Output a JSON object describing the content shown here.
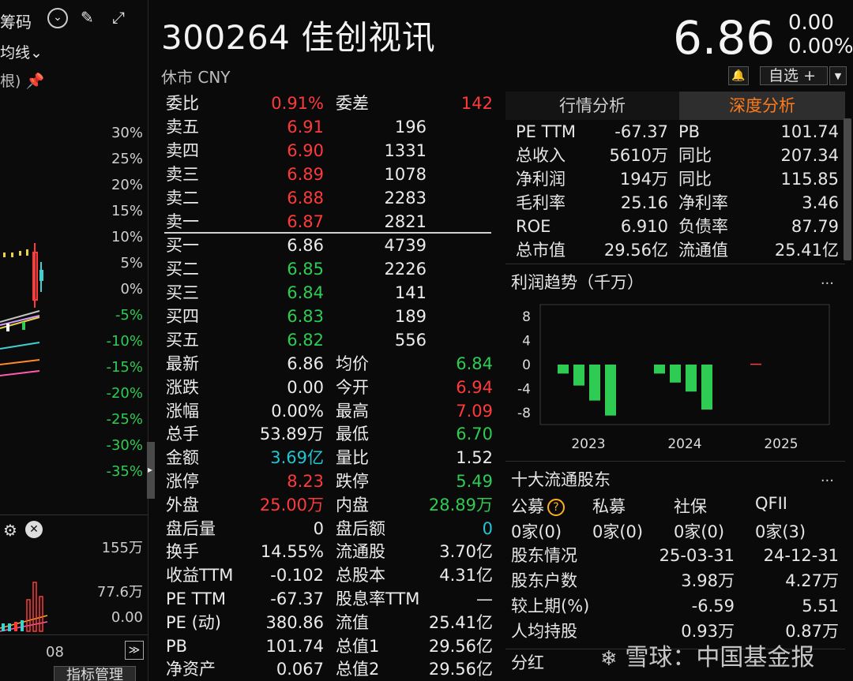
{
  "left_panel": {
    "top_label": "筹码",
    "ma_label": "均线",
    "ma_chevron": "⌄",
    "bracket_label": "根)",
    "y_axis": [
      "30%",
      "25%",
      "20%",
      "15%",
      "10%",
      "5%",
      "0%",
      "-5%",
      "-10%",
      "-15%",
      "-20%",
      "-25%",
      "-30%",
      "-35%"
    ],
    "y_axis_colors": [
      "#d0d0d0",
      "#d0d0d0",
      "#d0d0d0",
      "#d0d0d0",
      "#d0d0d0",
      "#d0d0d0",
      "#d0d0d0",
      "#2ecc52",
      "#2ecc52",
      "#2ecc52",
      "#2ecc52",
      "#2ecc52",
      "#2ecc52",
      "#2ecc52"
    ],
    "vol_axis": [
      "155万",
      "77.6万",
      "0.00"
    ],
    "date_label": "08",
    "indicator_btn": "指标管理",
    "expand_arrow": "▸",
    "nav_right": "≫"
  },
  "header": {
    "code": "300264",
    "name": "佳创视讯",
    "market": "休市 CNY",
    "price": "6.86",
    "change": "0.00",
    "change_pct": "0.00%",
    "watch_label": "自选",
    "watch_plus": "+",
    "drop_arrow": "▼",
    "bell_glyph": "🔔"
  },
  "quote": {
    "top": {
      "l1": "委比",
      "v1": "0.91%",
      "l2": "委差",
      "v2": "142"
    },
    "asks": [
      {
        "label": "卖五",
        "price": "6.91",
        "vol": "196"
      },
      {
        "label": "卖四",
        "price": "6.90",
        "vol": "1331"
      },
      {
        "label": "卖三",
        "price": "6.89",
        "vol": "1078"
      },
      {
        "label": "卖二",
        "price": "6.88",
        "vol": "2283"
      },
      {
        "label": "卖一",
        "price": "6.87",
        "vol": "2821"
      }
    ],
    "bids": [
      {
        "label": "买一",
        "price": "6.86",
        "vol": "4739"
      },
      {
        "label": "买二",
        "price": "6.85",
        "vol": "2226"
      },
      {
        "label": "买三",
        "price": "6.84",
        "vol": "141"
      },
      {
        "label": "买四",
        "price": "6.83",
        "vol": "189"
      },
      {
        "label": "买五",
        "price": "6.82",
        "vol": "556"
      }
    ],
    "stats": [
      {
        "l1": "最新",
        "v1": "6.86",
        "c1": "white",
        "l2": "均价",
        "v2": "6.84",
        "c2": "green"
      },
      {
        "l1": "涨跌",
        "v1": "0.00",
        "c1": "white",
        "l2": "今开",
        "v2": "6.94",
        "c2": "red"
      },
      {
        "l1": "涨幅",
        "v1": "0.00%",
        "c1": "white",
        "l2": "最高",
        "v2": "7.09",
        "c2": "red"
      },
      {
        "l1": "总手",
        "v1": "53.89万",
        "c1": "white",
        "l2": "最低",
        "v2": "6.70",
        "c2": "green"
      },
      {
        "l1": "金额",
        "v1": "3.69亿",
        "c1": "cyan",
        "l2": "量比",
        "v2": "1.52",
        "c2": "white"
      },
      {
        "l1": "涨停",
        "v1": "8.23",
        "c1": "red",
        "l2": "跌停",
        "v2": "5.49",
        "c2": "green"
      },
      {
        "l1": "外盘",
        "v1": "25.00万",
        "c1": "red",
        "l2": "内盘",
        "v2": "28.89万",
        "c2": "green"
      },
      {
        "l1": "盘后量",
        "v1": "0",
        "c1": "white",
        "l2": "盘后额",
        "v2": "0",
        "c2": "cyan"
      },
      {
        "l1": "换手",
        "v1": "14.55%",
        "c1": "white",
        "l2": "流通股",
        "v2": "3.70亿",
        "c2": "white"
      },
      {
        "l1": "收益TTM",
        "v1": "-0.102",
        "c1": "white",
        "l2": "总股本",
        "v2": "4.31亿",
        "c2": "white"
      },
      {
        "l1": "PE TTM",
        "v1": "-67.37",
        "c1": "white",
        "l2": "股息率TTM",
        "v2": "—",
        "c2": "white"
      },
      {
        "l1": "PE (动)",
        "v1": "380.86",
        "c1": "white",
        "l2": "流值",
        "v2": "25.41亿",
        "c2": "white"
      },
      {
        "l1": "PB",
        "v1": "101.74",
        "c1": "white",
        "l2": "总值1",
        "v2": "29.56亿",
        "c2": "white"
      },
      {
        "l1": "净资产",
        "v1": "0.067",
        "c1": "white",
        "l2": "总值2",
        "v2": "29.56亿",
        "c2": "white"
      }
    ]
  },
  "right": {
    "tabs": [
      "行情分析",
      "深度分析"
    ],
    "fundamentals": [
      {
        "l1": "PE TTM",
        "v1": "-67.37",
        "l2": "PB",
        "v2": "101.74"
      },
      {
        "l1": "总收入",
        "v1": "5610万",
        "l2": "同比",
        "v2": "207.34"
      },
      {
        "l1": "净利润",
        "v1": "194万",
        "l2": "同比",
        "v2": "115.85"
      },
      {
        "l1": "毛利率",
        "v1": "25.16",
        "l2": "净利率",
        "v2": "3.46"
      },
      {
        "l1": "ROE",
        "v1": "6.910",
        "l2": "负债率",
        "v2": "87.79"
      },
      {
        "l1": "总市值",
        "v1": "29.56亿",
        "l2": "流通值",
        "v2": "25.41亿"
      }
    ],
    "profit_title": "利润趋势（千万）",
    "more": "...",
    "holders_title": "十大流通股东",
    "holder_types": [
      "公募",
      "私募",
      "社保",
      "QFII"
    ],
    "holder_counts": [
      "0家(0)",
      "0家(0)",
      "0家(0)",
      "0家(3)"
    ],
    "help_glyph": "?",
    "shareholders": {
      "header": {
        "label": "股东情况",
        "a": "25-03-31",
        "b": "24-12-31"
      },
      "rows": [
        {
          "label": "股东户数",
          "a": "3.98万",
          "b": "4.27万"
        },
        {
          "label": "较上期(%)",
          "a": "-6.59",
          "b": "5.51"
        },
        {
          "label": "人均持股",
          "a": "0.93万",
          "b": "0.87万"
        }
      ]
    },
    "dividend_title": "分红"
  },
  "watermark": "雪球：中国基金报",
  "chart_data": {
    "type": "bar",
    "title": "利润趋势（千万）",
    "y_ticks": [
      8,
      4,
      0,
      -4,
      -8
    ],
    "ylim": [
      -10,
      10
    ],
    "x_labels": [
      "2023",
      "2024",
      "2025"
    ],
    "values": [
      -1.5,
      -3.5,
      -6.0,
      -8.5,
      -1.5,
      -3.0,
      -4.5,
      -7.5,
      0.15
    ],
    "colors": [
      "#2ecc52",
      "#2ecc52",
      "#2ecc52",
      "#2ecc52",
      "#2ecc52",
      "#2ecc52",
      "#2ecc52",
      "#2ecc52",
      "#ff3a3a"
    ],
    "grid": false
  }
}
